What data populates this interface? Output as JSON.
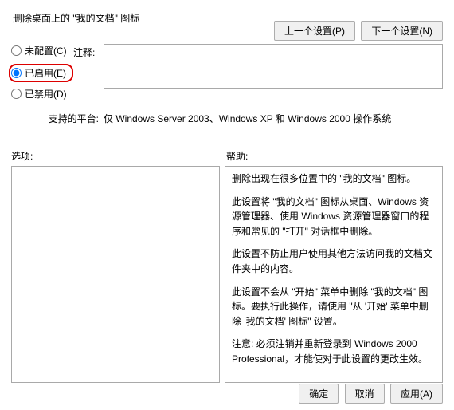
{
  "title": "删除桌面上的 \"我的文档\" 图标",
  "nav": {
    "prev": "上一个设置(P)",
    "next": "下一个设置(N)"
  },
  "radios": {
    "unconfigured": "未配置(C)",
    "enabled": "已启用(E)",
    "disabled": "已禁用(D)",
    "selected": "enabled"
  },
  "commentLabel": "注释:",
  "commentValue": "",
  "platform": {
    "label": "支持的平台:",
    "text": "仅 Windows Server 2003、Windows XP 和 Windows 2000 操作系统"
  },
  "sections": {
    "options": "选项:",
    "help": "帮助:"
  },
  "help": {
    "p1": "删除出现在很多位置中的 \"我的文档\" 图标。",
    "p2": "此设置将 \"我的文档\" 图标从桌面、Windows 资源管理器、使用 Windows 资源管理器窗口的程序和常见的 \"打开\" 对话框中删除。",
    "p3": "此设置不防止用户使用其他方法访问我的文档文件夹中的内容。",
    "p4": "此设置不会从 \"开始\" 菜单中删除 \"我的文档\" 图标。要执行此操作，请使用 \"从 '开始' 菜单中删除 '我的文档' 图标\" 设置。",
    "p5": "注意: 必须注销并重新登录到 Windows 2000 Professional，才能使对于此设置的更改生效。"
  },
  "footer": {
    "ok": "确定",
    "cancel": "取消",
    "apply": "应用(A)"
  }
}
